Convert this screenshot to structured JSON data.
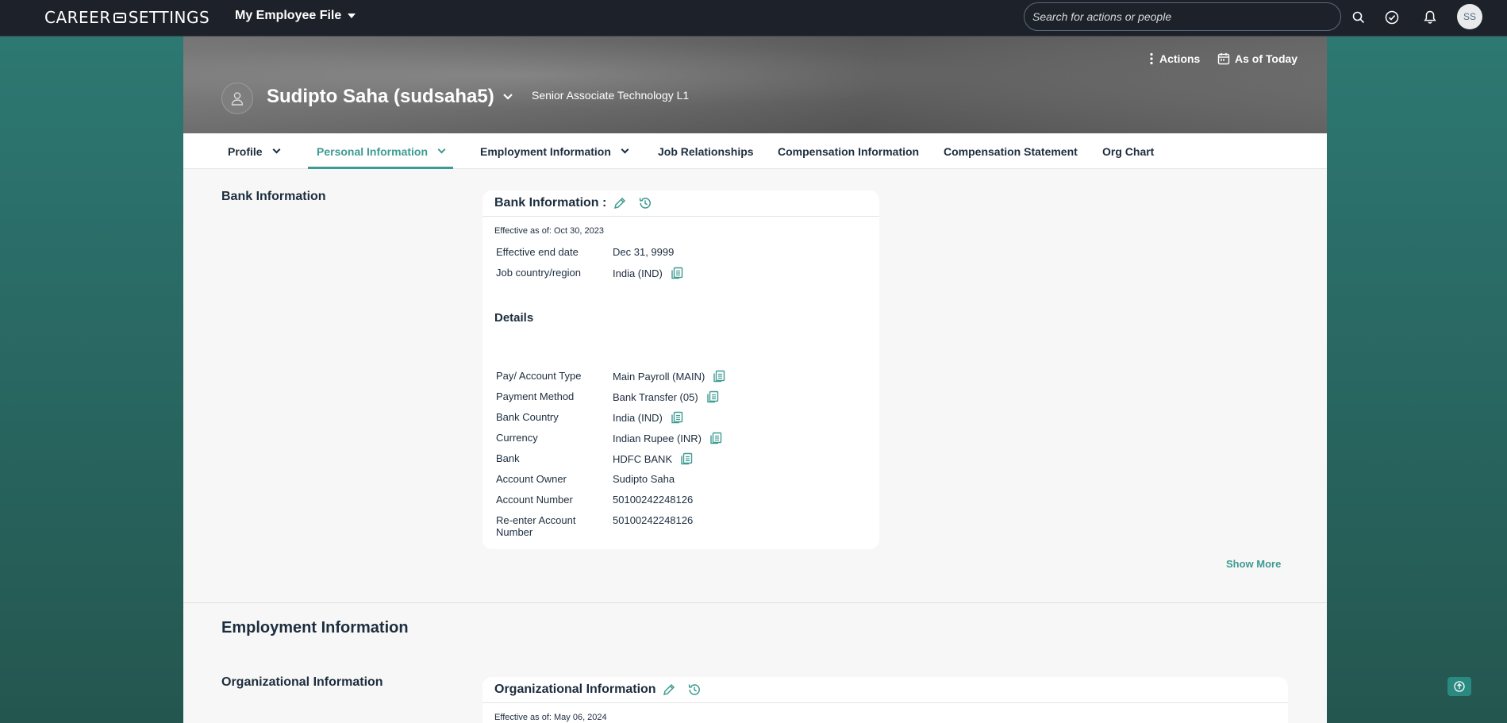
{
  "shell": {
    "logo_left": "CAREER",
    "logo_right": "SETTINGS",
    "app_title": "My Employee File",
    "search_placeholder": "Search for actions or people",
    "avatar_initials": "SS"
  },
  "header": {
    "actions_label": "Actions",
    "asof_label": "As of Today",
    "person_name": "Sudipto Saha (sudsaha5)",
    "person_title": "Senior Associate Technology L1"
  },
  "tabs": [
    {
      "label": "Profile",
      "has_menu": true,
      "active": false
    },
    {
      "label": "Personal Information",
      "has_menu": true,
      "active": true
    },
    {
      "label": "Employment Information",
      "has_menu": true,
      "active": false
    },
    {
      "label": "Job Relationships",
      "has_menu": false,
      "active": false
    },
    {
      "label": "Compensation Information",
      "has_menu": false,
      "active": false
    },
    {
      "label": "Compensation Statement",
      "has_menu": false,
      "active": false
    },
    {
      "label": "Org Chart",
      "has_menu": false,
      "active": false
    }
  ],
  "bank_section": {
    "label": "Bank Information",
    "card_title": "Bank Information :",
    "effective_as_of": "Effective as of: Oct 30, 2023",
    "top_rows": [
      {
        "label": "Effective end date",
        "value": "Dec 31, 9999",
        "copy": false
      },
      {
        "label": "Job country/region",
        "value": "India (IND)",
        "copy": true
      }
    ],
    "details_heading": "Details",
    "detail_rows": [
      {
        "label": "Pay/ Account Type",
        "value": "Main Payroll (MAIN)",
        "copy": true
      },
      {
        "label": "Payment Method",
        "value": "Bank Transfer (05)",
        "copy": true
      },
      {
        "label": "Bank Country",
        "value": "India (IND)",
        "copy": true
      },
      {
        "label": "Currency",
        "value": "Indian Rupee (INR)",
        "copy": true
      },
      {
        "label": "Bank",
        "value": "HDFC BANK",
        "copy": true
      },
      {
        "label": "Account Owner",
        "value": "Sudipto Saha",
        "copy": false
      },
      {
        "label": "Account Number",
        "value": "50100242248126",
        "copy": false
      },
      {
        "label": "Re-enter Account Number",
        "value": "50100242248126",
        "copy": false
      }
    ],
    "show_more": "Show More"
  },
  "employment_section": {
    "heading": "Employment Information",
    "org_label": "Organizational Information",
    "card_title": "Organizational Information",
    "effective_as_of": "Effective as of: May 06, 2024"
  },
  "colors": {
    "accent": "#3d9b91",
    "shell_bg": "#1d2129",
    "text": "#1d2d3e"
  }
}
